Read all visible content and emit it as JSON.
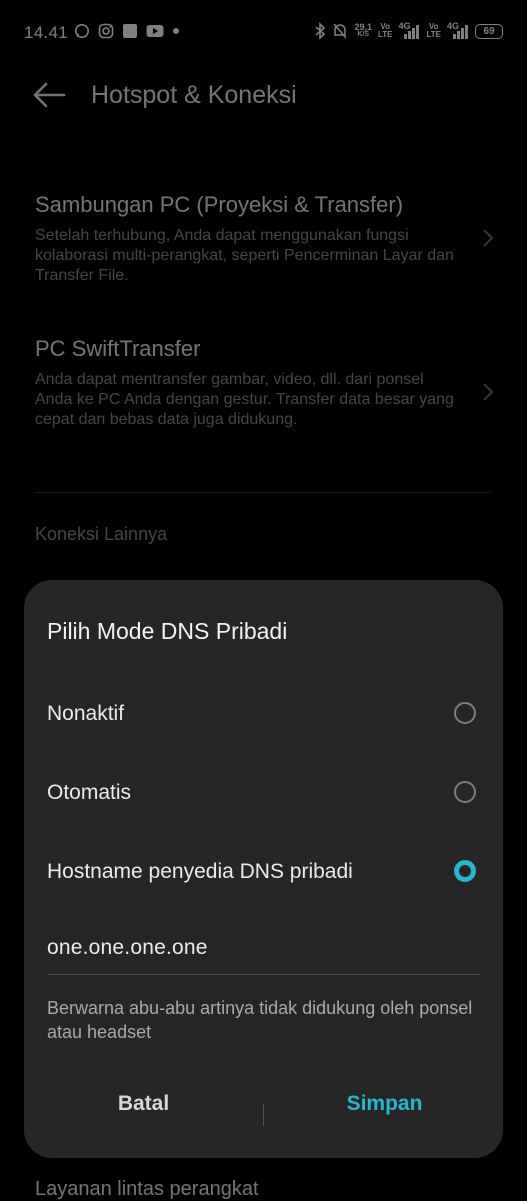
{
  "status_bar": {
    "time": "14.41",
    "net_speed": "29,1",
    "net_unit": "K/S",
    "sim1": "Vo\nLTE",
    "sim1_net": "4G",
    "sim2": "Vo\nLTE",
    "sim2_net": "4G",
    "battery": "69"
  },
  "page": {
    "title": "Hotspot & Koneksi"
  },
  "items": [
    {
      "title": "Sambungan PC (Proyeksi & Transfer)",
      "description": "Setelah terhubung, Anda dapat menggunakan fungsi kolaborasi multi-perangkat, seperti Pencerminan Layar dan Transfer File."
    },
    {
      "title": "PC SwiftTransfer",
      "description": "Anda dapat mentransfer gambar, video, dll. dari ponsel Anda ke PC Anda dengan gestur. Transfer data besar yang cepat dan bebas data juga didukung."
    }
  ],
  "section_header": "Koneksi Lainnya",
  "bottom_peek": "Layanan lintas perangkat",
  "dialog": {
    "title": "Pilih Mode DNS Pribadi",
    "options": [
      {
        "label": "Nonaktif",
        "selected": false
      },
      {
        "label": "Otomatis",
        "selected": false
      },
      {
        "label": "Hostname penyedia DNS pribadi",
        "selected": true
      }
    ],
    "hostname_value": "one.one.one.one",
    "help_text": "Berwarna abu-abu artinya tidak didukung oleh ponsel atau headset",
    "cancel_label": "Batal",
    "save_label": "Simpan"
  },
  "colors": {
    "accent": "#22b8cf",
    "dialog_bg": "#262626",
    "background": "#000000"
  },
  "icons": {
    "back": "arrow-left-icon",
    "chevron": "chevron-right-icon"
  }
}
